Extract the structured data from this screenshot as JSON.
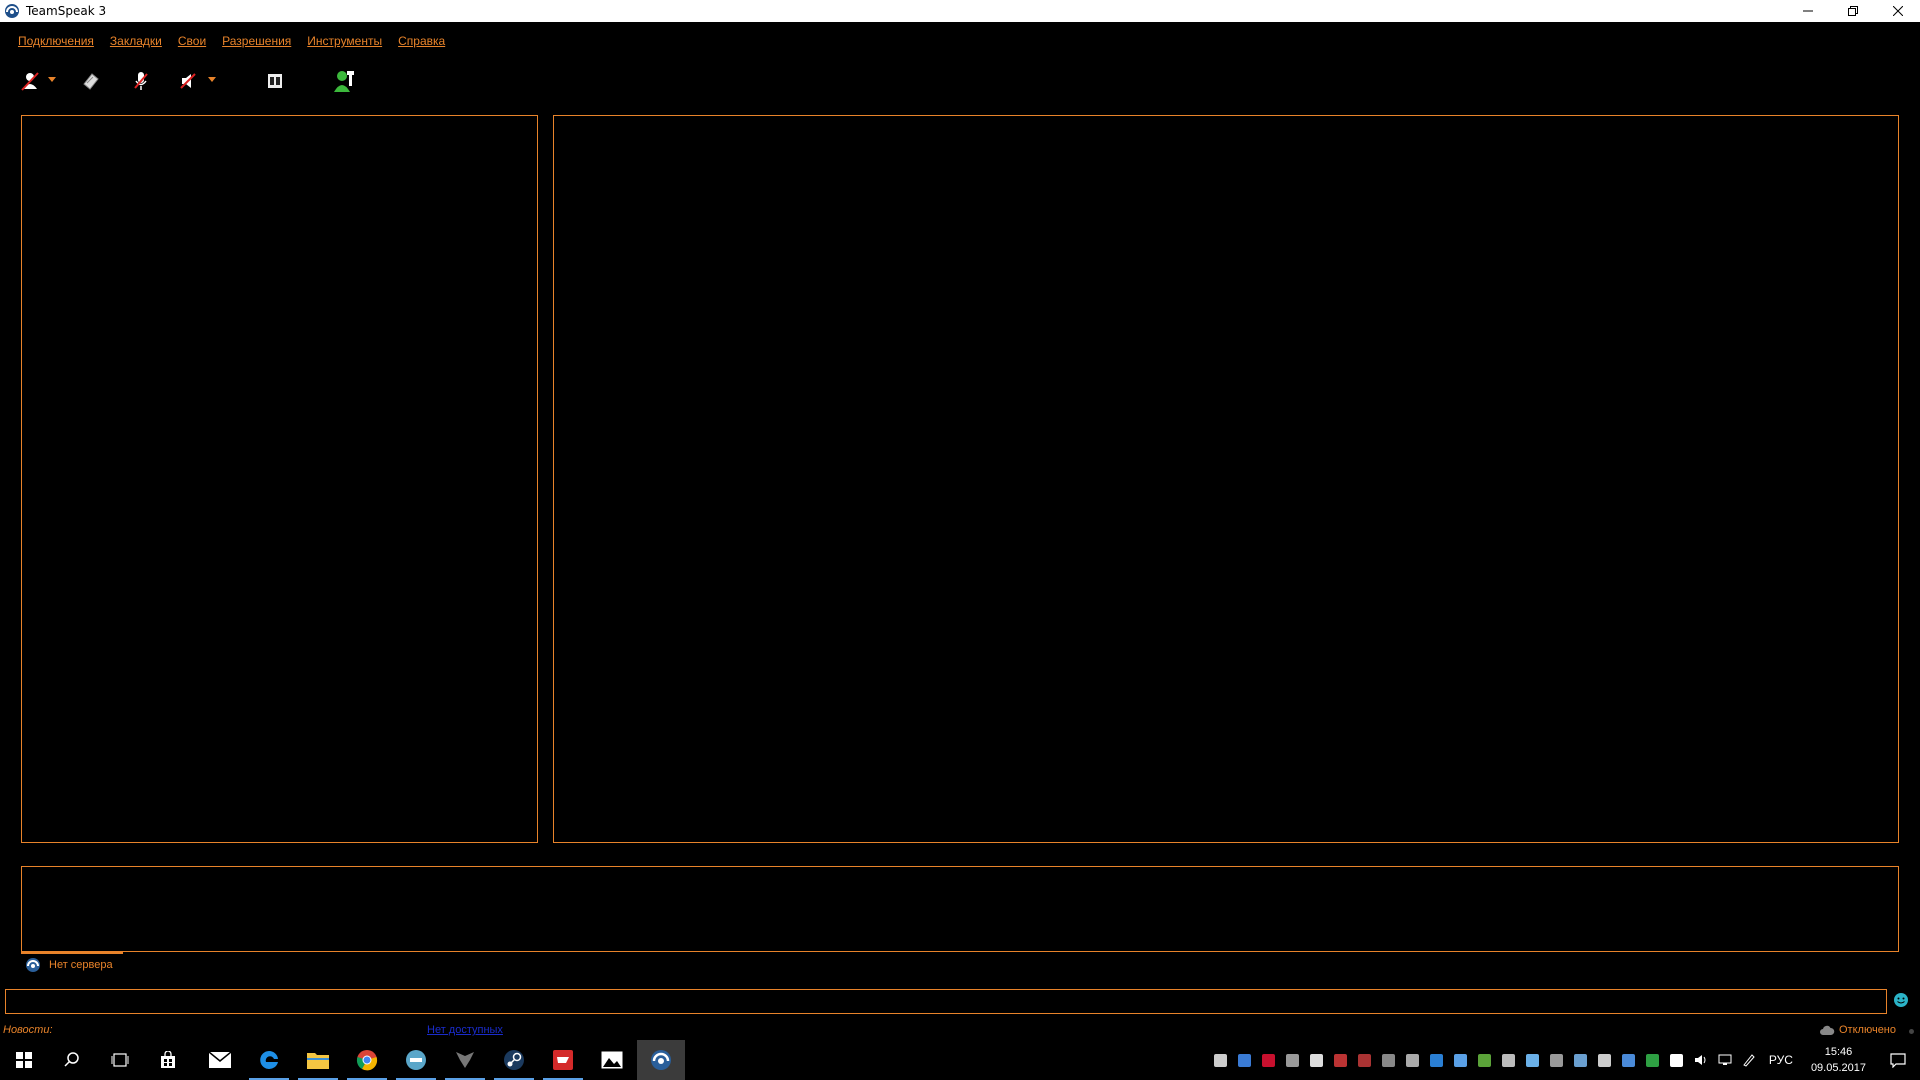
{
  "window": {
    "title": "TeamSpeak 3"
  },
  "menu": [
    "Подключения",
    "Закладки",
    "Свои",
    "Разрешения",
    "Инструменты",
    "Справка"
  ],
  "toolbar": {
    "icons": [
      "connect-icon",
      "disconnect-icon",
      "mute-microphone-icon",
      "mute-speakers-icon",
      "away-icon",
      "subscribe-icon"
    ]
  },
  "chat": {
    "tab_label": "Нет сервера",
    "input_value": ""
  },
  "statusbar": {
    "news_label": "Новости:",
    "update_link": "Нет доступных",
    "connection_status": "Отключено"
  },
  "taskbar": {
    "language": "РУС",
    "time": "15:46",
    "date": "09.05.2017"
  },
  "colors": {
    "accent": "#e8832a",
    "background": "#000000",
    "link": "#1a2ccc"
  }
}
